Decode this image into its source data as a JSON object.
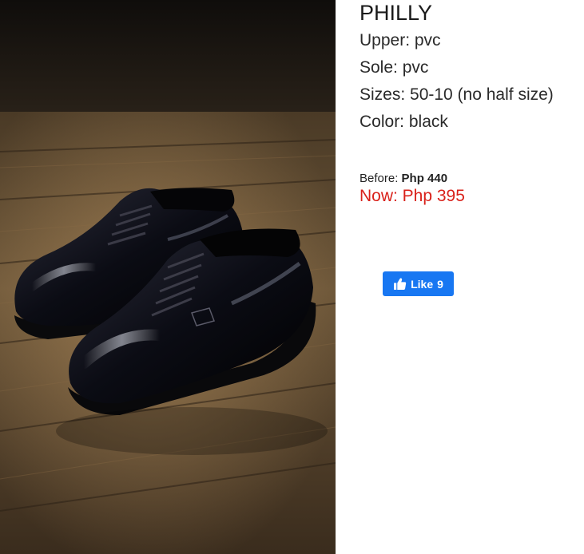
{
  "product": {
    "name": "PHILLY",
    "specs": [
      "Upper: pvc",
      "Sole: pvc",
      "Sizes: 50-10 (no half size)",
      "Color: black"
    ],
    "price_before_label": "Before:",
    "price_before_value": "Php 440",
    "price_now": "Now: Php 395",
    "image_alt": "black patent leather lace-up shoes",
    "colors": {
      "now_price": "#d9211a",
      "like_button": "#1877f2"
    }
  },
  "social": {
    "like_label": "Like",
    "like_count": "9",
    "icon": "thumbs-up-icon"
  }
}
